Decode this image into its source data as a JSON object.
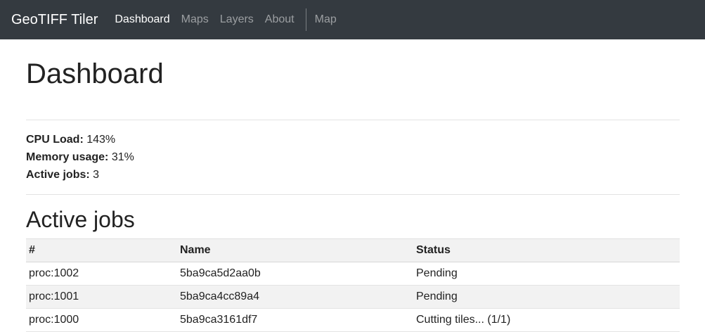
{
  "navbar": {
    "brand": "GeoTIFF Tiler",
    "links": [
      {
        "label": "Dashboard",
        "active": true
      },
      {
        "label": "Maps",
        "active": false
      },
      {
        "label": "Layers",
        "active": false
      },
      {
        "label": "About",
        "active": false
      }
    ],
    "extra_link": "Map"
  },
  "page": {
    "title": "Dashboard"
  },
  "stats": {
    "cpu_label": "CPU Load:",
    "cpu_value": "143%",
    "memory_label": "Memory usage:",
    "memory_value": "31%",
    "jobs_label": "Active jobs:",
    "jobs_value": "3"
  },
  "jobs_section": {
    "title": "Active jobs",
    "columns": [
      "#",
      "Name",
      "Status"
    ],
    "rows": [
      {
        "id": "proc:1002",
        "name": "5ba9ca5d2aa0b",
        "status": "Pending"
      },
      {
        "id": "proc:1001",
        "name": "5ba9ca4cc89a4",
        "status": "Pending"
      },
      {
        "id": "proc:1000",
        "name": "5ba9ca3161df7",
        "status": "Cutting tiles... (1/1)"
      }
    ]
  },
  "colors": {
    "navbar_bg": "#343a40",
    "stripe_bg": "#f2f2f2"
  }
}
